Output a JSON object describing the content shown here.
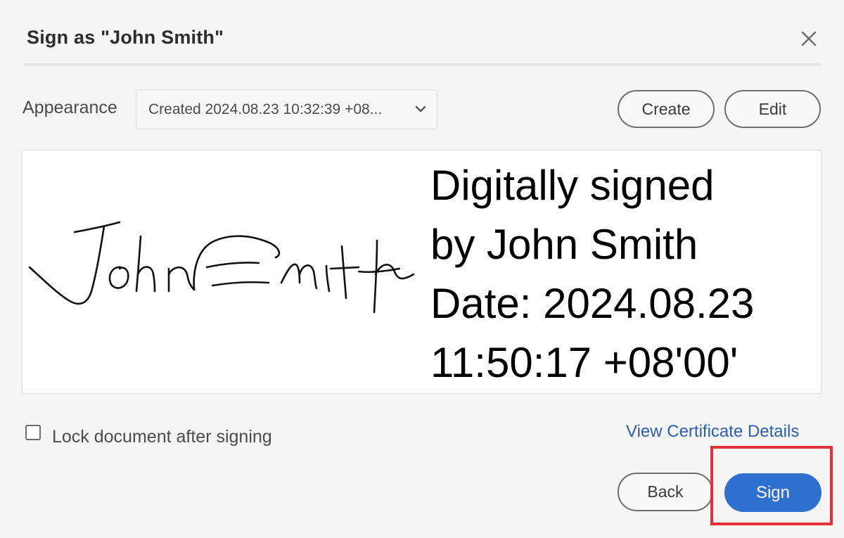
{
  "dialog": {
    "title": "Sign as \"John Smith\"",
    "close_icon": "close-icon"
  },
  "appearance": {
    "label": "Appearance",
    "selected": "Created 2024.08.23 10:32:39 +08...",
    "dropdown_icon": "chevron-down-icon",
    "create_label": "Create",
    "edit_label": "Edit"
  },
  "preview": {
    "signature_name": "John Smith",
    "text_lines": [
      "Digitally signed",
      "by John Smith",
      "Date: 2024.08.23",
      "11:50:17 +08'00'"
    ]
  },
  "options": {
    "lock_label": "Lock document after signing",
    "lock_checked": false,
    "cert_link": "View Certificate Details"
  },
  "footer": {
    "back_label": "Back",
    "sign_label": "Sign"
  },
  "colors": {
    "primary_button": "#2f70cf",
    "link": "#2d5ea8",
    "highlight": "#e0313b",
    "background": "#f5f5f5"
  }
}
